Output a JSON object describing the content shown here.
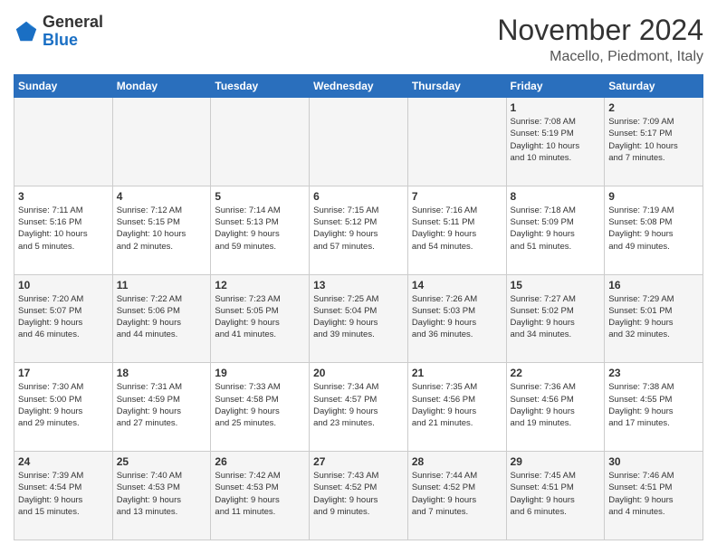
{
  "logo": {
    "general": "General",
    "blue": "Blue"
  },
  "header": {
    "title": "November 2024",
    "location": "Macello, Piedmont, Italy"
  },
  "weekdays": [
    "Sunday",
    "Monday",
    "Tuesday",
    "Wednesday",
    "Thursday",
    "Friday",
    "Saturday"
  ],
  "weeks": [
    [
      {
        "day": "",
        "info": ""
      },
      {
        "day": "",
        "info": ""
      },
      {
        "day": "",
        "info": ""
      },
      {
        "day": "",
        "info": ""
      },
      {
        "day": "",
        "info": ""
      },
      {
        "day": "1",
        "info": "Sunrise: 7:08 AM\nSunset: 5:19 PM\nDaylight: 10 hours\nand 10 minutes."
      },
      {
        "day": "2",
        "info": "Sunrise: 7:09 AM\nSunset: 5:17 PM\nDaylight: 10 hours\nand 7 minutes."
      }
    ],
    [
      {
        "day": "3",
        "info": "Sunrise: 7:11 AM\nSunset: 5:16 PM\nDaylight: 10 hours\nand 5 minutes."
      },
      {
        "day": "4",
        "info": "Sunrise: 7:12 AM\nSunset: 5:15 PM\nDaylight: 10 hours\nand 2 minutes."
      },
      {
        "day": "5",
        "info": "Sunrise: 7:14 AM\nSunset: 5:13 PM\nDaylight: 9 hours\nand 59 minutes."
      },
      {
        "day": "6",
        "info": "Sunrise: 7:15 AM\nSunset: 5:12 PM\nDaylight: 9 hours\nand 57 minutes."
      },
      {
        "day": "7",
        "info": "Sunrise: 7:16 AM\nSunset: 5:11 PM\nDaylight: 9 hours\nand 54 minutes."
      },
      {
        "day": "8",
        "info": "Sunrise: 7:18 AM\nSunset: 5:09 PM\nDaylight: 9 hours\nand 51 minutes."
      },
      {
        "day": "9",
        "info": "Sunrise: 7:19 AM\nSunset: 5:08 PM\nDaylight: 9 hours\nand 49 minutes."
      }
    ],
    [
      {
        "day": "10",
        "info": "Sunrise: 7:20 AM\nSunset: 5:07 PM\nDaylight: 9 hours\nand 46 minutes."
      },
      {
        "day": "11",
        "info": "Sunrise: 7:22 AM\nSunset: 5:06 PM\nDaylight: 9 hours\nand 44 minutes."
      },
      {
        "day": "12",
        "info": "Sunrise: 7:23 AM\nSunset: 5:05 PM\nDaylight: 9 hours\nand 41 minutes."
      },
      {
        "day": "13",
        "info": "Sunrise: 7:25 AM\nSunset: 5:04 PM\nDaylight: 9 hours\nand 39 minutes."
      },
      {
        "day": "14",
        "info": "Sunrise: 7:26 AM\nSunset: 5:03 PM\nDaylight: 9 hours\nand 36 minutes."
      },
      {
        "day": "15",
        "info": "Sunrise: 7:27 AM\nSunset: 5:02 PM\nDaylight: 9 hours\nand 34 minutes."
      },
      {
        "day": "16",
        "info": "Sunrise: 7:29 AM\nSunset: 5:01 PM\nDaylight: 9 hours\nand 32 minutes."
      }
    ],
    [
      {
        "day": "17",
        "info": "Sunrise: 7:30 AM\nSunset: 5:00 PM\nDaylight: 9 hours\nand 29 minutes."
      },
      {
        "day": "18",
        "info": "Sunrise: 7:31 AM\nSunset: 4:59 PM\nDaylight: 9 hours\nand 27 minutes."
      },
      {
        "day": "19",
        "info": "Sunrise: 7:33 AM\nSunset: 4:58 PM\nDaylight: 9 hours\nand 25 minutes."
      },
      {
        "day": "20",
        "info": "Sunrise: 7:34 AM\nSunset: 4:57 PM\nDaylight: 9 hours\nand 23 minutes."
      },
      {
        "day": "21",
        "info": "Sunrise: 7:35 AM\nSunset: 4:56 PM\nDaylight: 9 hours\nand 21 minutes."
      },
      {
        "day": "22",
        "info": "Sunrise: 7:36 AM\nSunset: 4:56 PM\nDaylight: 9 hours\nand 19 minutes."
      },
      {
        "day": "23",
        "info": "Sunrise: 7:38 AM\nSunset: 4:55 PM\nDaylight: 9 hours\nand 17 minutes."
      }
    ],
    [
      {
        "day": "24",
        "info": "Sunrise: 7:39 AM\nSunset: 4:54 PM\nDaylight: 9 hours\nand 15 minutes."
      },
      {
        "day": "25",
        "info": "Sunrise: 7:40 AM\nSunset: 4:53 PM\nDaylight: 9 hours\nand 13 minutes."
      },
      {
        "day": "26",
        "info": "Sunrise: 7:42 AM\nSunset: 4:53 PM\nDaylight: 9 hours\nand 11 minutes."
      },
      {
        "day": "27",
        "info": "Sunrise: 7:43 AM\nSunset: 4:52 PM\nDaylight: 9 hours\nand 9 minutes."
      },
      {
        "day": "28",
        "info": "Sunrise: 7:44 AM\nSunset: 4:52 PM\nDaylight: 9 hours\nand 7 minutes."
      },
      {
        "day": "29",
        "info": "Sunrise: 7:45 AM\nSunset: 4:51 PM\nDaylight: 9 hours\nand 6 minutes."
      },
      {
        "day": "30",
        "info": "Sunrise: 7:46 AM\nSunset: 4:51 PM\nDaylight: 9 hours\nand 4 minutes."
      }
    ]
  ]
}
